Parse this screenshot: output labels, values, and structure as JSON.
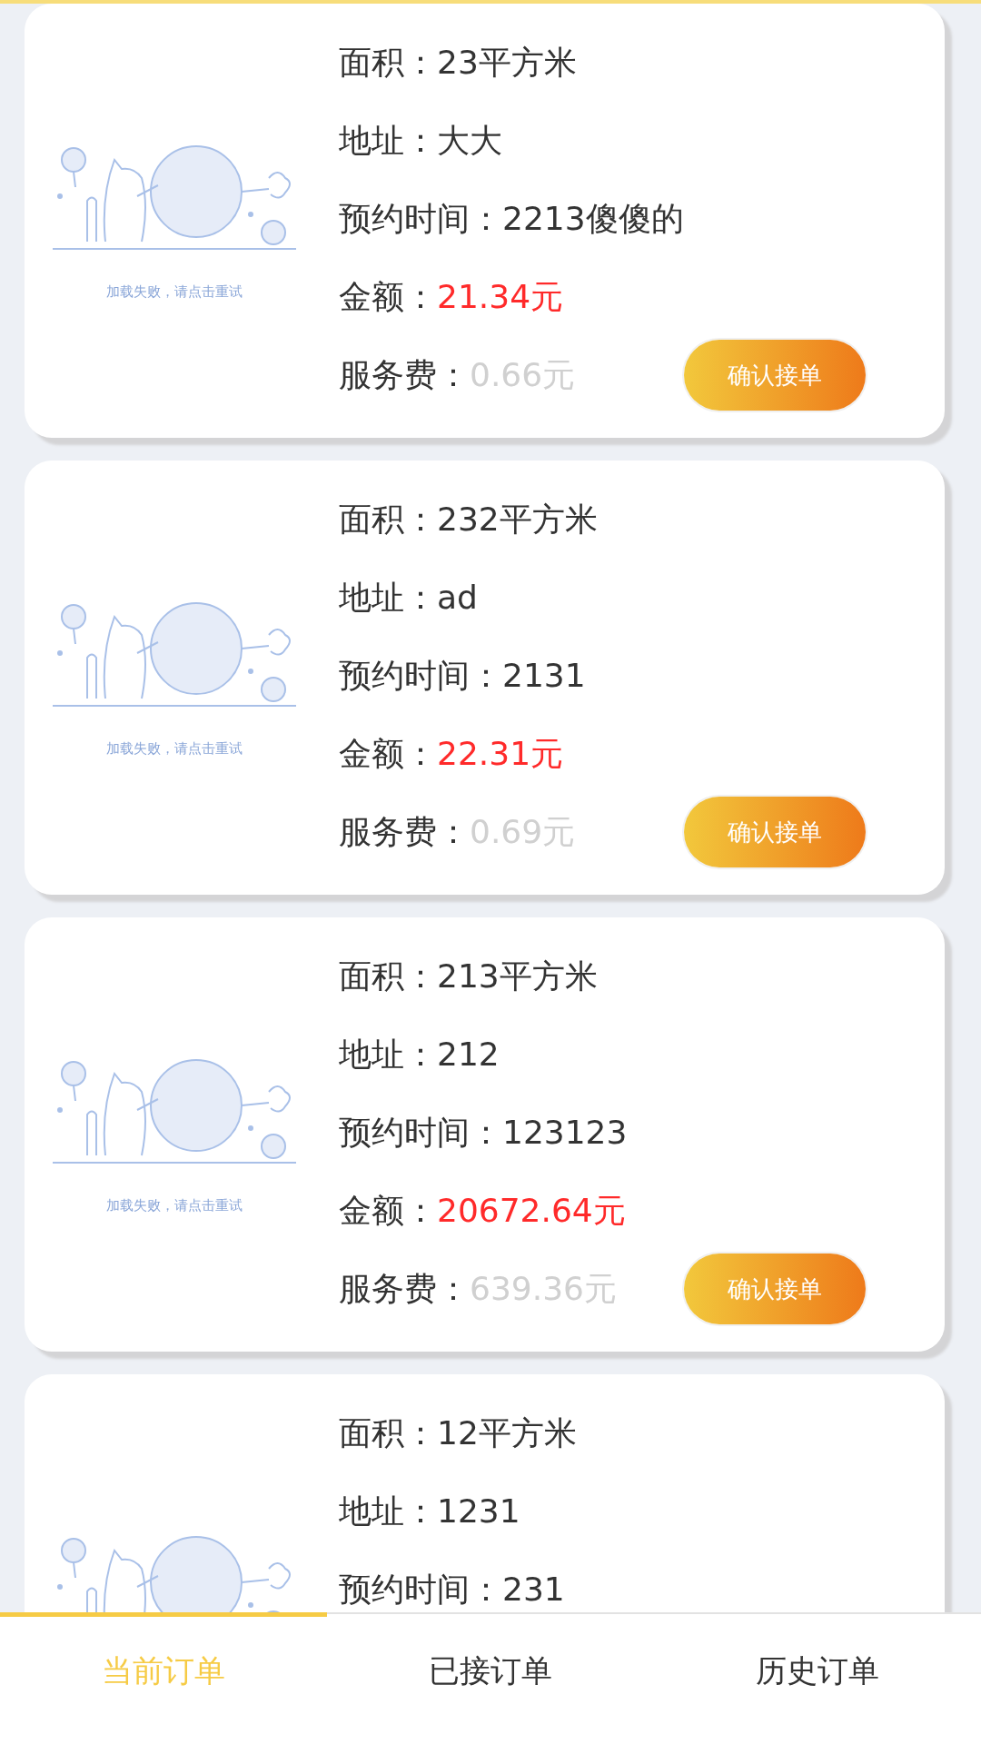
{
  "orders": [
    {
      "image_caption": "加载失败，请点击重试",
      "fields": [
        {
          "kind": "plain",
          "label": "面积：",
          "value": "23平方米"
        },
        {
          "kind": "plain",
          "label": "地址：",
          "value": "大大"
        },
        {
          "kind": "plain",
          "label": "预约时间：",
          "value": "2213傻傻的"
        },
        {
          "kind": "amount",
          "label": "金额：",
          "value": "21.34元"
        },
        {
          "kind": "fee",
          "label": "服务费：",
          "value": "0.66元"
        }
      ],
      "button": "确认接单"
    },
    {
      "image_caption": "加载失败，请点击重试",
      "fields": [
        {
          "kind": "plain",
          "label": "面积：",
          "value": "232平方米"
        },
        {
          "kind": "plain",
          "label": "地址：",
          "value": "ad"
        },
        {
          "kind": "plain",
          "label": "预约时间：",
          "value": "2131"
        },
        {
          "kind": "amount",
          "label": "金额：",
          "value": "22.31元"
        },
        {
          "kind": "fee",
          "label": "服务费：",
          "value": "0.69元"
        }
      ],
      "button": "确认接单"
    },
    {
      "image_caption": "加载失败，请点击重试",
      "fields": [
        {
          "kind": "plain",
          "label": "面积：",
          "value": "213平方米"
        },
        {
          "kind": "plain",
          "label": "地址：",
          "value": "212"
        },
        {
          "kind": "plain",
          "label": "预约时间：",
          "value": "123123"
        },
        {
          "kind": "amount",
          "label": "金额：",
          "value": "20672.64元"
        },
        {
          "kind": "fee",
          "label": "服务费：",
          "value": "639.36元"
        }
      ],
      "button": "确认接单"
    },
    {
      "fields": [
        {
          "kind": "plain",
          "label": "面积：",
          "value": "12平方米"
        },
        {
          "kind": "plain",
          "label": "地址：",
          "value": "1231"
        },
        {
          "kind": "plain",
          "label": "预约时间：",
          "value": "231"
        }
      ]
    }
  ],
  "tabs": [
    {
      "label": "当前订单",
      "selected": true
    },
    {
      "label": "已接订单",
      "selected": false
    },
    {
      "label": "历史订单",
      "selected": false
    }
  ]
}
